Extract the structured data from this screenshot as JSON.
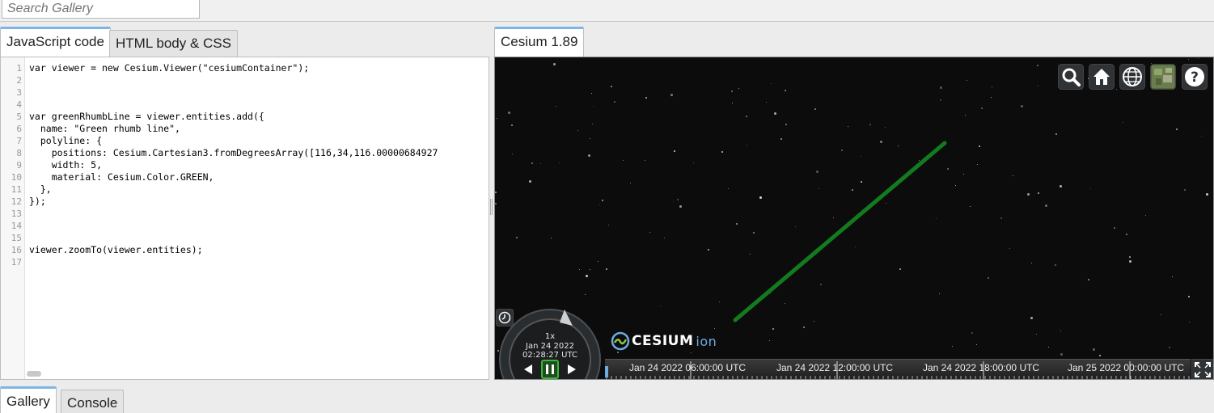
{
  "search": {
    "placeholder": "Search Gallery"
  },
  "editor_tabs": [
    {
      "label": "JavaScript code",
      "active": true
    },
    {
      "label": "HTML body & CSS",
      "active": false
    }
  ],
  "viewer_tab": {
    "label": "Cesium 1.89"
  },
  "code": {
    "line_numbers": [
      "1",
      "2",
      "3",
      "4",
      "5",
      "6",
      "7",
      "8",
      "9",
      "10",
      "11",
      "12",
      "13",
      "14",
      "15",
      "16",
      "17"
    ],
    "lines": [
      "var viewer = new Cesium.Viewer(\"cesiumContainer\");",
      "",
      "",
      "",
      "var greenRhumbLine = viewer.entities.add({",
      "  name: \"Green rhumb line\",",
      "  polyline: {",
      "    positions: Cesium.Cartesian3.fromDegreesArray([116,34,116.00000684927",
      "    width: 5,",
      "    material: Cesium.Color.GREEN,",
      "  },",
      "});",
      "",
      "",
      "",
      "viewer.zoomTo(viewer.entities);",
      ""
    ]
  },
  "viewer_toolbar": [
    {
      "name": "search-icon"
    },
    {
      "name": "home-icon"
    },
    {
      "name": "globe-icon"
    },
    {
      "name": "imagery-picker-icon"
    },
    {
      "name": "help-icon"
    }
  ],
  "logo": {
    "brand": "CESIUM",
    "suffix": "ion"
  },
  "animation": {
    "speed": "1x",
    "date": "Jan 24 2022",
    "time": "02:28:27 UTC"
  },
  "timeline": {
    "labels": [
      "Jan 24 2022 06:00:00 UTC",
      "Jan 24 2022 12:00:00 UTC",
      "Jan 24 2022 18:00:00 UTC",
      "Jan 25 2022 00:00:00 UTC"
    ]
  },
  "bottom_tabs": [
    {
      "label": "Gallery",
      "active": true
    },
    {
      "label": "Console",
      "active": false
    }
  ],
  "colors": {
    "polyline": "#137a1f",
    "accent": "#7cb6e6"
  }
}
